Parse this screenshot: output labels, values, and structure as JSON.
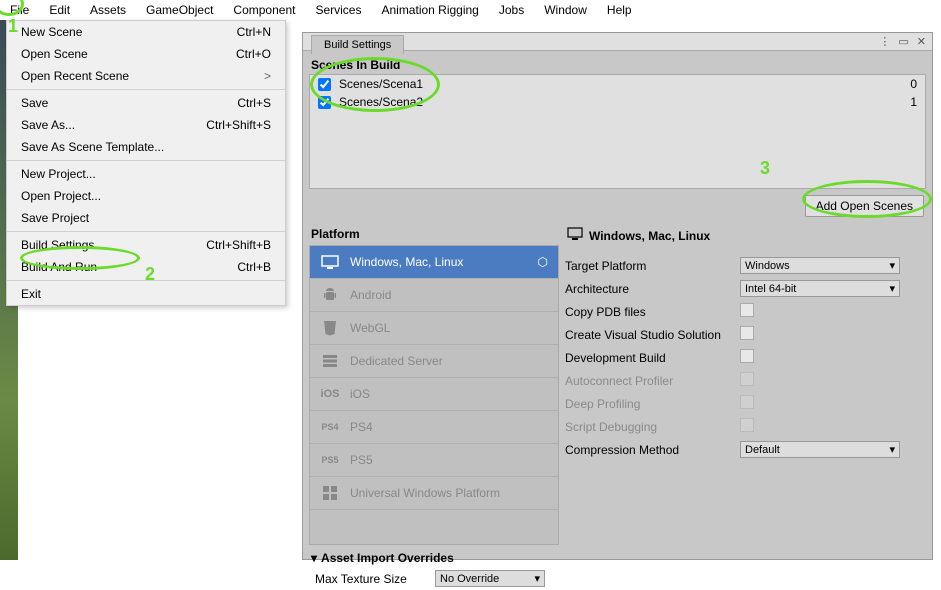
{
  "menubar": [
    "File",
    "Edit",
    "Assets",
    "GameObject",
    "Component",
    "Services",
    "Animation Rigging",
    "Jobs",
    "Window",
    "Help"
  ],
  "file_menu": [
    {
      "label": "New Scene",
      "shortcut": "Ctrl+N",
      "sep": false
    },
    {
      "label": "Open Scene",
      "shortcut": "Ctrl+O",
      "sep": false
    },
    {
      "label": "Open Recent Scene",
      "shortcut": "",
      "arrow": true,
      "sep": true
    },
    {
      "label": "Save",
      "shortcut": "Ctrl+S",
      "sep": false
    },
    {
      "label": "Save As...",
      "shortcut": "Ctrl+Shift+S",
      "sep": false
    },
    {
      "label": "Save As Scene Template...",
      "shortcut": "",
      "sep": true
    },
    {
      "label": "New Project...",
      "shortcut": "",
      "sep": false
    },
    {
      "label": "Open Project...",
      "shortcut": "",
      "sep": false
    },
    {
      "label": "Save Project",
      "shortcut": "",
      "sep": true
    },
    {
      "label": "Build Settings...",
      "shortcut": "Ctrl+Shift+B",
      "sep": false
    },
    {
      "label": "Build And Run",
      "shortcut": "Ctrl+B",
      "sep": true
    },
    {
      "label": "Exit",
      "shortcut": "",
      "sep": false
    }
  ],
  "build_tab": "Build Settings",
  "scenes_header": "Scenes In Build",
  "scenes": [
    {
      "name": "Scenes/Scena1",
      "checked": true,
      "index": "0"
    },
    {
      "name": "Scenes/Scena2",
      "checked": true,
      "index": "1"
    }
  ],
  "add_open": "Add Open Scenes",
  "platform_header": "Platform",
  "platforms": [
    {
      "label": "Windows, Mac, Linux",
      "selected": true,
      "icon": "monitor-icon",
      "unity": true
    },
    {
      "label": "Android",
      "icon": "android-icon"
    },
    {
      "label": "WebGL",
      "icon": "html5-icon"
    },
    {
      "label": "Dedicated Server",
      "icon": "server-icon"
    },
    {
      "label": "iOS",
      "icon": "ios-icon"
    },
    {
      "label": "PS4",
      "icon": "ps4-icon"
    },
    {
      "label": "PS5",
      "icon": "ps5-icon"
    },
    {
      "label": "Universal Windows Platform",
      "icon": "windows-icon"
    }
  ],
  "target_header": "Windows, Mac, Linux",
  "settings": {
    "target_platform_label": "Target Platform",
    "target_platform": "Windows",
    "architecture_label": "Architecture",
    "architecture": "Intel 64-bit",
    "copy_pdb_label": "Copy PDB files",
    "vs_solution_label": "Create Visual Studio Solution",
    "dev_build_label": "Development Build",
    "autoconnect_label": "Autoconnect Profiler",
    "deep_profiling_label": "Deep Profiling",
    "script_debug_label": "Script Debugging",
    "compression_label": "Compression Method",
    "compression": "Default"
  },
  "asset_header": "Asset Import Overrides",
  "asset_row": {
    "label": "Max Texture Size",
    "value": "No Override"
  },
  "annotations": {
    "one": "1",
    "two": "2",
    "three": "3"
  }
}
